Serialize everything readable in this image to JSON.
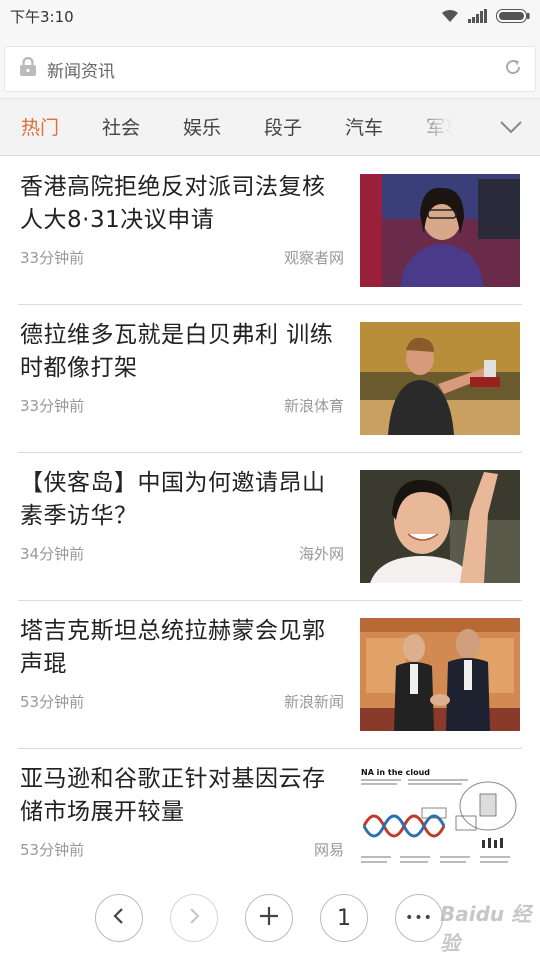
{
  "status_bar": {
    "time": "下午3:10"
  },
  "address_bar": {
    "text": "新闻资讯"
  },
  "tabs": [
    {
      "label": "热门",
      "active": true
    },
    {
      "label": "社会"
    },
    {
      "label": "娱乐"
    },
    {
      "label": "段子"
    },
    {
      "label": "汽车"
    },
    {
      "label": "军事"
    }
  ],
  "news": [
    {
      "title": "香港高院拒绝反对派司法复核人大8·31决议申请",
      "time": "33分钟前",
      "source": "观察者网"
    },
    {
      "title": "德拉维多瓦就是白贝弗利 训练时都像打架",
      "time": "33分钟前",
      "source": "新浪体育"
    },
    {
      "title": "【侠客岛】中国为何邀请昂山素季访华？",
      "time": "34分钟前",
      "source": "海外网"
    },
    {
      "title": "塔吉克斯坦总统拉赫蒙会见郭声琨",
      "time": "53分钟前",
      "source": "新浪新闻"
    },
    {
      "title": "亚马逊和谷歌正针对基因云存储市场展开较量",
      "time": "53分钟前",
      "source": "网易"
    }
  ],
  "thumb_texts": {
    "dna_cloud": "NA in the cloud"
  },
  "toolbar": {
    "tab_count": "1",
    "more_glyph": "•••"
  },
  "watermark": "Baidu 经验",
  "colors": {
    "accent": "#e06d3a",
    "text": "#222222",
    "meta": "#999999"
  },
  "icons": [
    "lock-icon",
    "refresh-icon",
    "chevron-down-icon",
    "back-icon",
    "forward-icon",
    "plus-icon",
    "more-icon",
    "wifi-icon",
    "signal-icon",
    "battery-icon"
  ]
}
